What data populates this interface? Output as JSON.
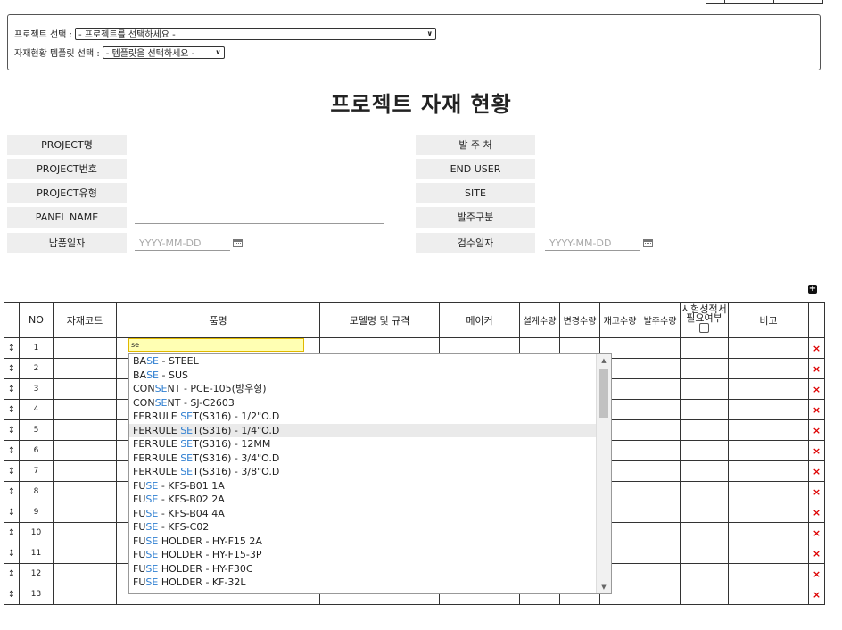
{
  "selectors": {
    "project_label": "프로젝트 선택 :",
    "project_value": "- 프로젝트를 선택하세요 -",
    "template_label": "자재현황 템플릿 선택 :",
    "template_value": "- 템플릿을 선택하세요 -"
  },
  "page_title": "프로젝트 자재 현황",
  "form": {
    "project_name": "PROJECT명",
    "project_no": "PROJECT번호",
    "project_type": "PROJECT유형",
    "panel_name": "PANEL NAME",
    "delivery_date": "납품일자",
    "client": "발 주 처",
    "end_user": "END USER",
    "site": "SITE",
    "order_type": "발주구분",
    "inspection_date": "검수일자",
    "date_placeholder": "YYYY-MM-DD"
  },
  "table": {
    "headers": {
      "no": "NO",
      "code": "자재코드",
      "item": "품명",
      "model": "모델명 및 규격",
      "maker": "메이커",
      "design_qty": "설계수량",
      "change_qty": "변경수량",
      "stock_qty": "재고수량",
      "order_qty": "발주수량",
      "test_cert_1": "시험성적서",
      "test_cert_2": "필요여부",
      "remark": "비고"
    },
    "row_numbers": [
      "1",
      "2",
      "3",
      "4",
      "5",
      "6",
      "7",
      "8",
      "9",
      "10",
      "11",
      "12",
      "13"
    ],
    "drag_glyph": "↕",
    "delete_glyph": "×",
    "active_input_value": "se"
  },
  "autocomplete": {
    "items": [
      {
        "pre": "BA",
        "match": "SE",
        "post": " - STEEL"
      },
      {
        "pre": "BA",
        "match": "SE",
        "post": " - SUS"
      },
      {
        "pre": "CON",
        "match": "SE",
        "post": "NT - PCE-105(방우형)"
      },
      {
        "pre": "CON",
        "match": "SE",
        "post": "NT - SJ-C2603"
      },
      {
        "pre": "FERRULE ",
        "match": "SE",
        "post": "T(S316) - 1/2\"O.D"
      },
      {
        "pre": "FERRULE ",
        "match": "SE",
        "post": "T(S316) - 1/4\"O.D"
      },
      {
        "pre": "FERRULE ",
        "match": "SE",
        "post": "T(S316) - 12MM"
      },
      {
        "pre": "FERRULE ",
        "match": "SE",
        "post": "T(S316) - 3/4\"O.D"
      },
      {
        "pre": "FERRULE ",
        "match": "SE",
        "post": "T(S316) - 3/8\"O.D"
      },
      {
        "pre": "FU",
        "match": "SE",
        "post": " - KFS-B01 1A"
      },
      {
        "pre": "FU",
        "match": "SE",
        "post": " - KFS-B02 2A"
      },
      {
        "pre": "FU",
        "match": "SE",
        "post": " - KFS-B04 4A"
      },
      {
        "pre": "FU",
        "match": "SE",
        "post": " - KFS-C02"
      },
      {
        "pre": "FU",
        "match": "SE",
        "post": " HOLDER - HY-F15 2A"
      },
      {
        "pre": "FU",
        "match": "SE",
        "post": " HOLDER - HY-F15-3P"
      },
      {
        "pre": "FU",
        "match": "SE",
        "post": " HOLDER - HY-F30C"
      },
      {
        "pre": "FU",
        "match": "SE",
        "post": " HOLDER - KF-32L"
      }
    ],
    "highlighted_index": 5
  },
  "colors": {
    "match": "#2f7fd1",
    "delete": "#dd0000",
    "active_input_bg": "#ffffb3"
  }
}
